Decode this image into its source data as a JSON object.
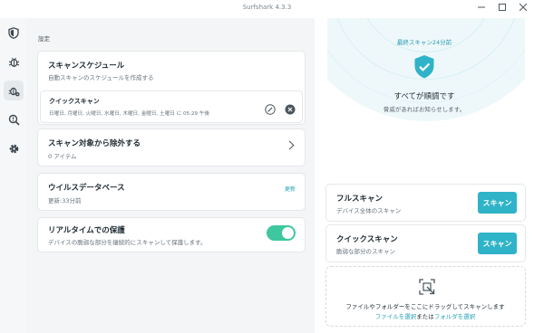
{
  "window": {
    "title": "Surfshark 4.3.3",
    "controls": [
      "minimize",
      "maximize",
      "close"
    ]
  },
  "sidebar": {
    "items": [
      {
        "icon": "shield-icon"
      },
      {
        "icon": "bug-icon"
      },
      {
        "icon": "antivirus-bug-gear-icon",
        "active": true
      },
      {
        "icon": "search-alert-icon"
      },
      {
        "icon": "gear-icon"
      }
    ]
  },
  "settings": {
    "section_label": "設定",
    "schedule": {
      "title": "スキャンスケジュール",
      "subtitle": "自動スキャンのスケジュールを作成する",
      "quick_scan": {
        "title": "クイックスキャン",
        "detail": "日曜日, 月曜日, 火曜日, 水曜日, 木曜日, 金曜日, 土曜日 に 05:29 午後"
      }
    },
    "exclusions": {
      "title": "スキャン対象から除外する",
      "subtitle": "0 アイテム"
    },
    "database": {
      "title": "ウイルスデータベース",
      "subtitle": "更新:33分前",
      "update_label": "更新"
    },
    "realtime": {
      "title": "リアルタイムでの保護",
      "subtitle": "デバイスの脆弱な部分を継続的にスキャンして保護します。",
      "enabled": true
    }
  },
  "status": {
    "last_scan": "最終スキャン24分前",
    "headline": "すべてが順調です",
    "message": "脅威があればお知らせします。"
  },
  "scans": {
    "full": {
      "title": "フルスキャン",
      "subtitle": "デバイス全体のスキャン",
      "button": "スキャン"
    },
    "quick": {
      "title": "クイックスキャン",
      "subtitle": "脆弱な部分のスキャン",
      "button": "スキャン"
    }
  },
  "dropzone": {
    "line1": "ファイルやフォルダーをここにドラッグしてスキャンします",
    "select_file": "ファイルを選択",
    "or": "または",
    "select_folder": "フォルダを選択"
  },
  "colors": {
    "accent": "#2fb3c8",
    "toggle_on": "#3fc7a0",
    "link": "#25a0b6"
  }
}
